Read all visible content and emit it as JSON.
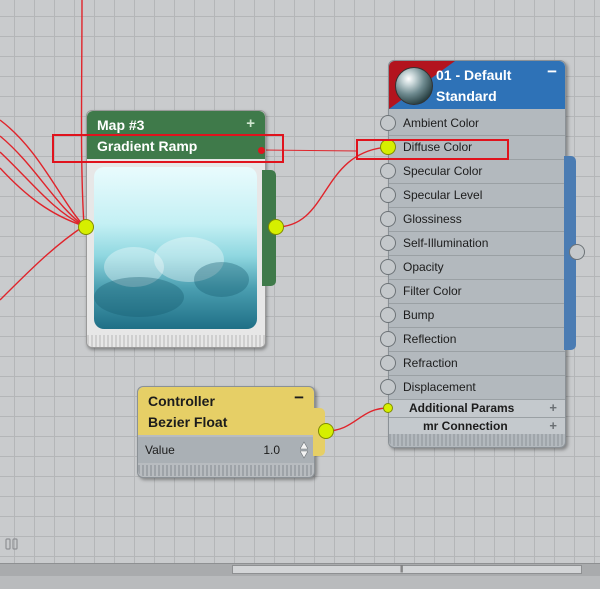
{
  "map_node": {
    "title": "Map #3",
    "subtitle": "Gradient Ramp",
    "plus": "+"
  },
  "material_node": {
    "title": "01 - Default",
    "subtitle": "Standard",
    "minus": "−",
    "slots": [
      {
        "label": "Ambient Color",
        "connected": false
      },
      {
        "label": "Diffuse Color",
        "connected": true
      },
      {
        "label": "Specular Color",
        "connected": false
      },
      {
        "label": "Specular Level",
        "connected": false
      },
      {
        "label": "Glossiness",
        "connected": false
      },
      {
        "label": "Self-Illumination",
        "connected": false
      },
      {
        "label": "Opacity",
        "connected": false
      },
      {
        "label": "Filter Color",
        "connected": false
      },
      {
        "label": "Bump",
        "connected": false
      },
      {
        "label": "Reflection",
        "connected": false
      },
      {
        "label": "Refraction",
        "connected": false
      },
      {
        "label": "Displacement",
        "connected": false
      }
    ],
    "rollouts": [
      {
        "label": "Additional Params",
        "plus": "+"
      },
      {
        "label": "mr Connection",
        "plus": "+"
      }
    ]
  },
  "controller_node": {
    "title": "Controller",
    "subtitle": "Bezier Float",
    "minus": "−",
    "param_label": "Value",
    "param_value": "1.0"
  },
  "colors": {
    "wire": "#e0242b",
    "highlight": "#e0131d",
    "connector_active": "#d6ef00",
    "map_header": "#3f7a4a",
    "material_header": "#2e72b7",
    "controller_header": "#e6cf66"
  }
}
